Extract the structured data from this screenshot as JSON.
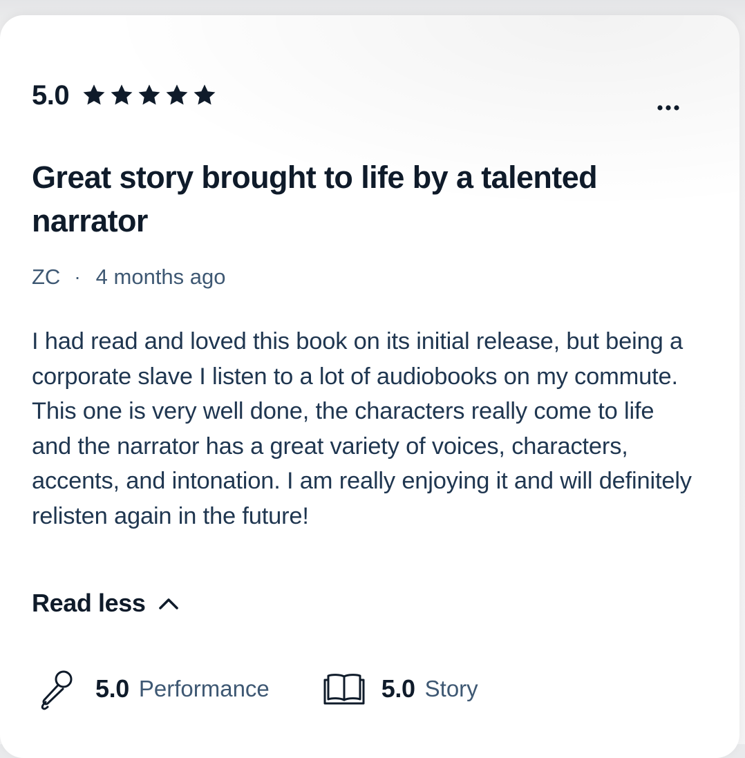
{
  "review": {
    "overall_rating": "5.0",
    "stars_filled": 5,
    "stars_total": 5,
    "title": "Great story brought to life by a talented narrator",
    "author": "ZC",
    "separator": "·",
    "posted": "4 months ago",
    "body": "I had read and loved this book on its initial release, but being a corporate slave I listen to a lot of audiobooks on my commute. This one is very well done, the characters really come to life and the narrator has a great variety of voices, characters, accents, and intonation. I am really enjoying it and will definitely relisten again in the future!",
    "read_less_label": "Read less",
    "sub_ratings": [
      {
        "icon": "microphone-icon",
        "value": "5.0",
        "label": "Performance"
      },
      {
        "icon": "open-book-icon",
        "value": "5.0",
        "label": "Story"
      }
    ]
  },
  "colors": {
    "heading": "#0f1b2a",
    "body_text": "#1f3650",
    "muted_text": "#3e5873",
    "card_background": "#ffffff"
  }
}
